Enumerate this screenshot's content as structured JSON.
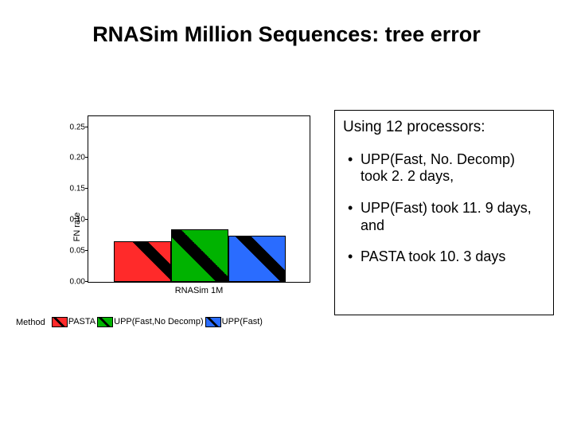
{
  "title": "RNASim Million Sequences: tree error",
  "chart": {
    "ylabel": "FN rate",
    "xlabel": "RNASim 1M",
    "yticks": [
      "0.00",
      "0.05",
      "0.10",
      "0.15",
      "0.20",
      "0.25"
    ],
    "legend_title": "Method",
    "legend": [
      {
        "name": "PASTA",
        "color": "#ff2a2a"
      },
      {
        "name": "UPP(Fast,No Decomp)",
        "color": "#00b300"
      },
      {
        "name": "UPP(Fast)",
        "color": "#2a6cff"
      }
    ]
  },
  "chart_data": {
    "type": "bar",
    "categories": [
      "RNASim 1M"
    ],
    "series": [
      {
        "name": "PASTA",
        "values": [
          0.065
        ]
      },
      {
        "name": "UPP(Fast,No Decomp)",
        "values": [
          0.085
        ]
      },
      {
        "name": "UPP(Fast)",
        "values": [
          0.075
        ]
      }
    ],
    "ylabel": "FN rate",
    "xlabel": "",
    "ylim": [
      0,
      0.27
    ]
  },
  "info": {
    "heading": "Using 12 processors:",
    "bullets": [
      "UPP(Fast, No. Decomp) took 2. 2 days,",
      "UPP(Fast) took 11. 9 days, and",
      "PASTA took 10. 3 days"
    ]
  }
}
